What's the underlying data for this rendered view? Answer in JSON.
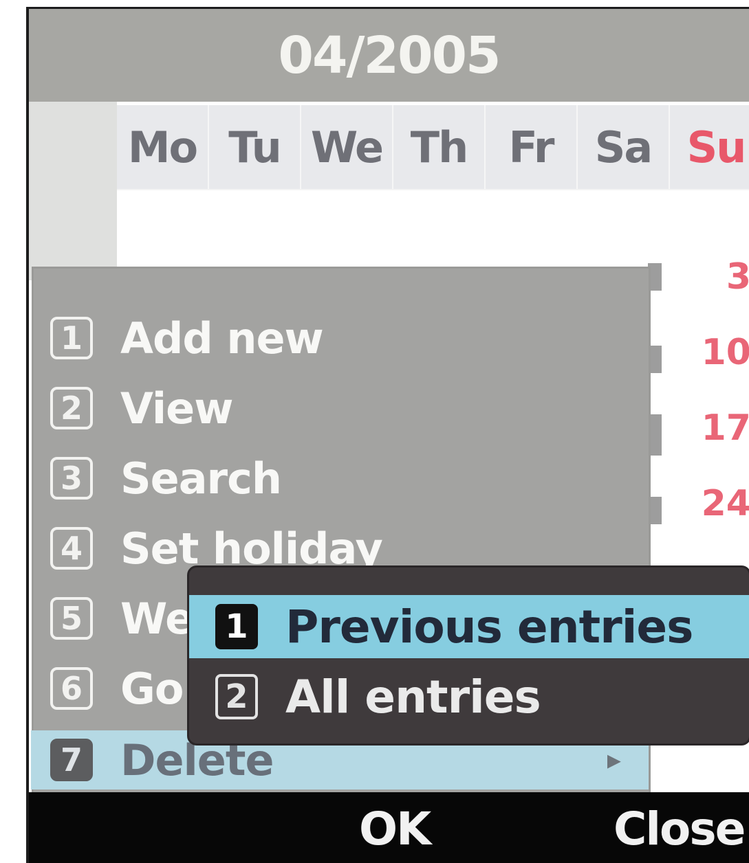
{
  "header": {
    "title": "04/2005"
  },
  "weekdays": [
    "Mo",
    "Tu",
    "We",
    "Th",
    "Fr",
    "Sa",
    "Su"
  ],
  "calendar": {
    "sunday_dates": [
      "3",
      "10",
      "17",
      "24"
    ]
  },
  "menu": {
    "items": [
      {
        "num": "1",
        "label": "Add new"
      },
      {
        "num": "2",
        "label": "View"
      },
      {
        "num": "3",
        "label": "Search"
      },
      {
        "num": "4",
        "label": "Set holiday"
      },
      {
        "num": "5",
        "label": "We"
      },
      {
        "num": "6",
        "label": "Go"
      },
      {
        "num": "7",
        "label": "Delete"
      }
    ],
    "selected_index": 6
  },
  "submenu": {
    "items": [
      {
        "num": "1",
        "label": "Previous entries"
      },
      {
        "num": "2",
        "label": "All entries"
      }
    ],
    "selected_index": 0
  },
  "softkeys": {
    "left": "OK",
    "right": "Close"
  },
  "colors": {
    "highlight_menu": "#b5d9e4",
    "highlight_submenu": "#86cde0",
    "sunday": "#e8586a",
    "title_bg": "#a7a7a3"
  }
}
